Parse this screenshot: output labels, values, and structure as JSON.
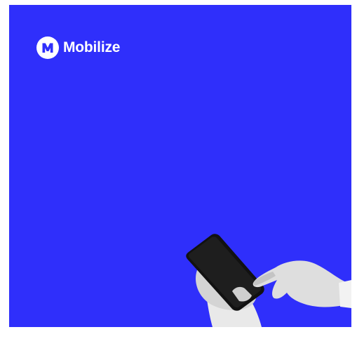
{
  "brand": {
    "name": "Mobilize",
    "logo_icon": "mobilize-m-logo-icon",
    "logo_color": "#ffffff",
    "logo_mark_color": "#2f2ffb"
  },
  "background": {
    "color": "#2f2ffb",
    "page_color": "#ffffff"
  },
  "image": {
    "subject": "hands-holding-smartphone",
    "style": "grayscale"
  }
}
